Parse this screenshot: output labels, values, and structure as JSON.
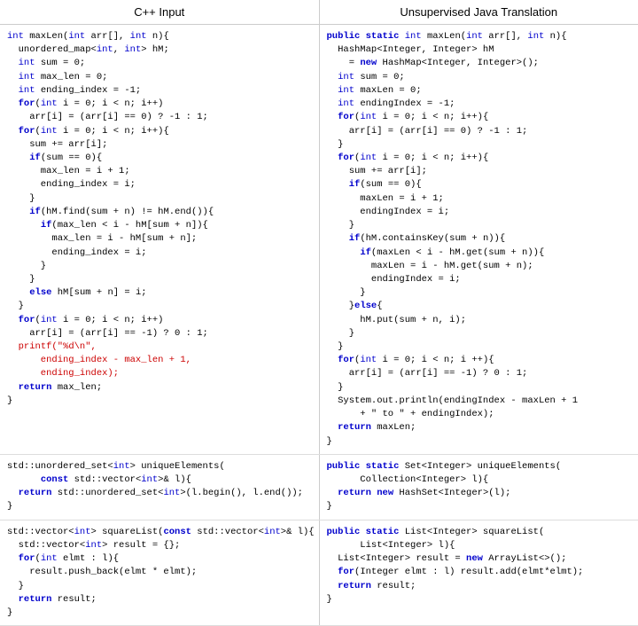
{
  "header": {
    "left_title": "C++ Input",
    "right_title": "Unsupervised Java Translation"
  },
  "sections": [
    {
      "id": "section1",
      "left_code": "int maxLen(int arr[], int n){\n  unordered_map<int, int> hM;\n  int sum = 0;\n  int max_len = 0;\n  int ending_index = -1;\n  for(int i = 0; i < n; i++)\n    arr[i] = (arr[i] == 0) ? -1 : 1;\n  for(int i = 0; i < n; i++){\n    sum += arr[i];\n    if(sum == 0){\n      max_len = i + 1;\n      ending_index = i;\n    }\n    if(hM.find(sum + n) != hM.end()){\n      if(max_len < i - hM[sum + n]){\n        max_len = i - hM[sum + n];\n        ending_index = i;\n      }\n    }\n    else hM[sum + n] = i;\n  }\n  for(int i = 0; i < n; i++)\n    arr[i] = (arr[i] == -1) ? 0 : 1;\n  printf(\"%d\\n\",\n      ending_index - max_len + 1,\n      ending_index);\n  return max_len;\n}",
      "right_code": "public static int maxLen(int arr[], int n){\n  HashMap<Integer, Integer> hM\n    = new HashMap<Integer, Integer>();\n  int sum = 0;\n  int maxLen = 0;\n  int endingIndex = -1;\n  for(int i = 0; i < n; i++){\n    arr[i] = (arr[i] == 0) ? -1 : 1;\n  }\n  for(int i = 0; i < n; i++){\n    sum += arr[i];\n    if(sum == 0){\n      maxLen = i + 1;\n      endingIndex = i;\n    }\n    if(hM.containsKey(sum + n)){\n      if(maxLen < i - hM.get(sum + n)){\n        maxLen = i - hM.get(sum + n);\n        endingIndex = i;\n      }\n    }else{\n      hM.put(sum + n, i);\n    }\n  }\n  for(int i = 0; i < n; i ++){\n    arr[i] = (arr[i] == -1) ? 0 : 1;\n  }\n  System.out.println(endingIndex - maxLen + 1\n      + \" to \" + endingIndex);\n  return maxLen;\n}"
    },
    {
      "id": "section2",
      "left_code": "std::unordered_set<int> uniqueElements(\n      const std::vector<int>& l){\n  return std::unordered_set<int>(l.begin(), l.end());\n}",
      "right_code": "public static Set<Integer> uniqueElements(\n      Collection<Integer> l){\n  return new HashSet<Integer>(l);\n}"
    },
    {
      "id": "section3",
      "left_code": "std::vector<int> squareList(const std::vector<int>& l){\n  std::vector<int> result = {};\n  for(int elmt : l){\n    result.push_back(elmt * elmt);\n  }\n  return result;\n}",
      "right_code": "public static List<Integer> squareList(\n      List<Integer> l){\n  List<Integer> result = new ArrayList<>();\n  for(Integer elmt : l) result.add(elmt*elmt);\n  return result;\n}"
    }
  ]
}
